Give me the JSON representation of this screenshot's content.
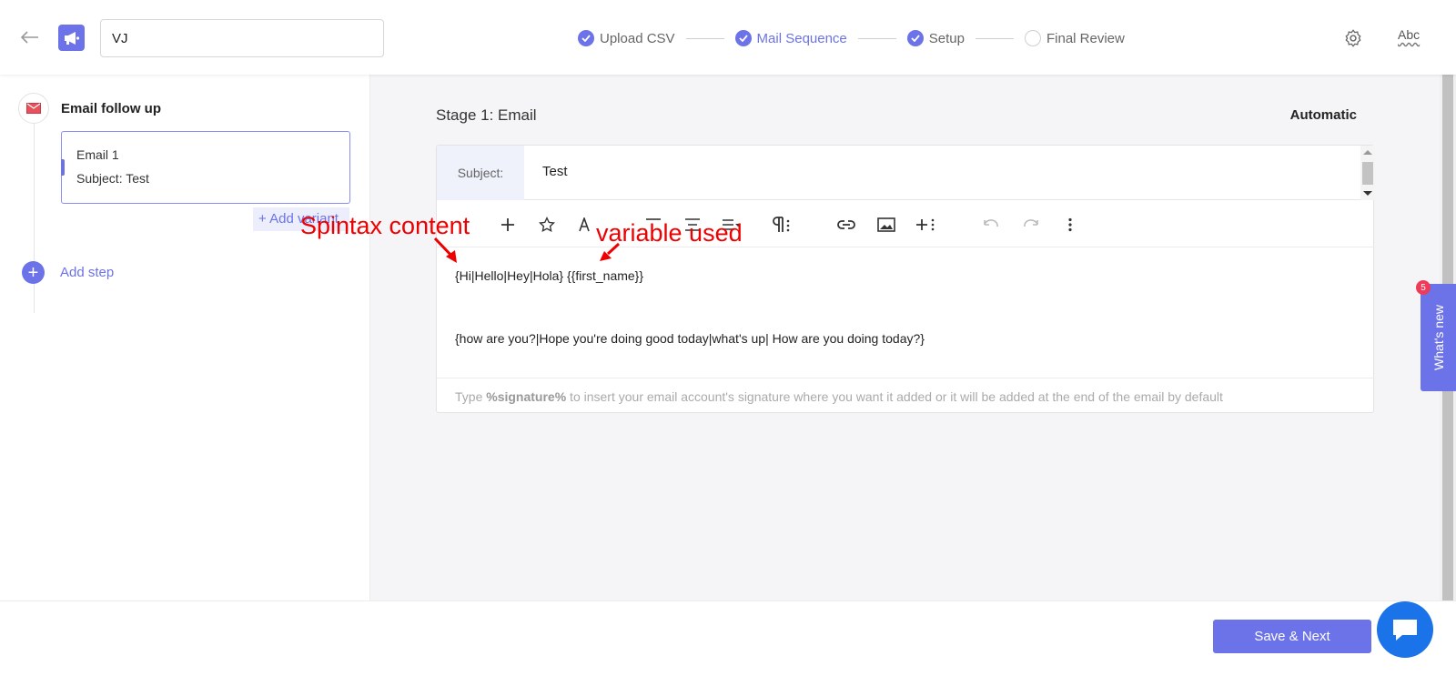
{
  "header": {
    "campaign_name": "VJ",
    "steps": [
      {
        "label": "Upload CSV",
        "state": "done"
      },
      {
        "label": "Mail Sequence",
        "state": "active"
      },
      {
        "label": "Setup",
        "state": "done"
      },
      {
        "label": "Final Review",
        "state": "todo"
      }
    ],
    "spell_label": "Abc"
  },
  "sidebar": {
    "sequence_title": "Email follow up",
    "email_card": {
      "title": "Email 1",
      "subject": "Subject: Test"
    },
    "add_variant": "+ Add variant",
    "add_step": "Add step"
  },
  "main": {
    "stage_title": "Stage 1: Email",
    "mode": "Automatic",
    "subject_label": "Subject:",
    "subject_value": "Test",
    "body_line1": "{Hi|Hello|Hey|Hola} {{first_name}}",
    "body_line2": "{how are you?|Hope you're doing good today|what's up| How are you doing today?}",
    "signature_prefix": "Type ",
    "signature_token": "%signature%",
    "signature_suffix": " to insert your email account's signature where you want it added or it will be added at the end of the email by default"
  },
  "annotations": {
    "spintax": "Spintax content",
    "variable": "variable used"
  },
  "whats_new": {
    "label": "What's new",
    "badge": "5"
  },
  "footer": {
    "save_label": "Save & Next"
  },
  "colors": {
    "accent": "#6c72e8",
    "annotation": "#ee0000",
    "chat": "#1a73e8",
    "badge": "#ef3b5a"
  }
}
